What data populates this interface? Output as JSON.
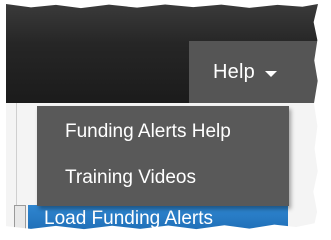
{
  "header": {
    "help_menu": {
      "label": "Help",
      "icon": "chevron-down-icon"
    }
  },
  "help_dropdown": {
    "items": [
      {
        "label": "Funding Alerts Help"
      },
      {
        "label": "Training Videos"
      }
    ]
  },
  "page": {
    "load_button_label": "Load Funding Alerts"
  },
  "colors": {
    "header_bar": "#1f1f1f",
    "help_tab": "#555555",
    "dropdown_bg": "#595959",
    "button_blue": "#1d6bb3",
    "text_light": "#ffffff"
  }
}
